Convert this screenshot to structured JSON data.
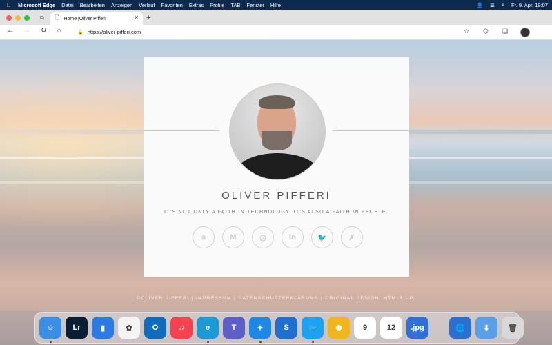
{
  "menubar": {
    "apple_icon": "apple-icon",
    "items": [
      "Microsoft Edge",
      "Datei",
      "Bearbeiten",
      "Anzeigen",
      "Verlauf",
      "Favoriten",
      "Extras",
      "Profile",
      "TAB",
      "Fenster",
      "Hilfe"
    ],
    "datetime": "Fr. 9. Apr.  19:07"
  },
  "browser": {
    "tab_title": "Home |Oliver Pifferi",
    "url": "https://oliver-pifferi.com",
    "traffic_colors": [
      "#ff5f57",
      "#febc2e",
      "#28c840"
    ]
  },
  "card": {
    "name": "OLIVER PIFFERI",
    "tagline": "IT'S NOT ONLY A FAITH IN TECHNOLOGY. IT'S ALSO A FAITH IN PEOPLE.",
    "socials": [
      {
        "icon": "amazon-icon",
        "glyph": "a"
      },
      {
        "icon": "medium-icon",
        "glyph": "M"
      },
      {
        "icon": "instagram-icon",
        "glyph": "◎"
      },
      {
        "icon": "linkedin-icon",
        "glyph": "in"
      },
      {
        "icon": "twitter-icon",
        "glyph": "🐦"
      },
      {
        "icon": "xing-icon",
        "glyph": "✗"
      }
    ]
  },
  "footer": {
    "text": "©OLIVER PIFFERI  |  IMPRESSUM  |  DATENSCHUTZERKLÄRUNG  |  ORIGINAL DESIGN: HTML5 UP."
  },
  "dock": [
    {
      "name": "finder-icon",
      "label": "☺",
      "color": "#3a8ee6"
    },
    {
      "name": "lightroom-icon",
      "label": "Lr",
      "color": "#0a1e33"
    },
    {
      "name": "bookmarks-icon",
      "label": "▮",
      "color": "#2c7be5"
    },
    {
      "name": "photos-icon",
      "label": "✿",
      "color": "#f4f4f4"
    },
    {
      "name": "outlook-icon",
      "label": "O",
      "color": "#0f6cbd"
    },
    {
      "name": "music-icon",
      "label": "♫",
      "color": "#f5424e"
    },
    {
      "name": "edge-icon",
      "label": "e",
      "color": "#1c9ad6"
    },
    {
      "name": "teams-icon",
      "label": "T",
      "color": "#5b5fc7"
    },
    {
      "name": "safari-icon",
      "label": "✦",
      "color": "#1e88e5"
    },
    {
      "name": "sandbox-icon",
      "label": "S",
      "color": "#1f6fd1"
    },
    {
      "name": "twitter-icon",
      "label": "🐦",
      "color": "#1da1f2"
    },
    {
      "name": "tes-icon",
      "label": "✺",
      "color": "#f2b51c"
    },
    {
      "name": "pages-icon",
      "label": "9",
      "color": "#ffffff"
    },
    {
      "name": "numbers-icon",
      "label": "12",
      "color": "#ffffff"
    },
    {
      "name": "jpg-icon",
      "label": ".jpg",
      "color": "#2f6fd6"
    },
    {
      "name": "globe-icon",
      "label": "🌐",
      "color": "#2b6fcf"
    },
    {
      "name": "downloads-icon",
      "label": "⬇",
      "color": "#5aa0e6"
    },
    {
      "name": "trash-icon",
      "label": "🗑",
      "color": "#d8d8d8"
    }
  ]
}
